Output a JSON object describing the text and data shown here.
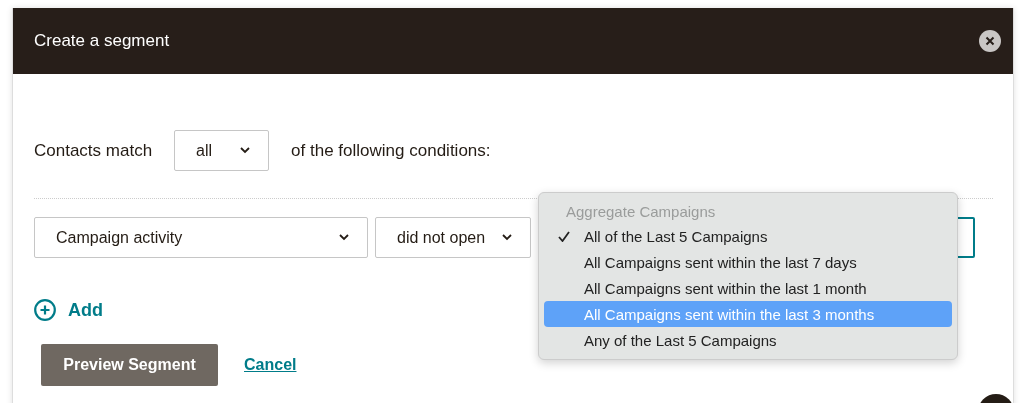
{
  "dialog": {
    "title": "Create a segment"
  },
  "match": {
    "prefix": "Contacts match",
    "value": "all",
    "suffix": "of the following conditions:"
  },
  "condition": {
    "field": "Campaign activity",
    "operator": "did not open",
    "focused": true
  },
  "add_label": "Add",
  "buttons": {
    "primary": "Preview Segment",
    "cancel": "Cancel"
  },
  "menu": {
    "group": "Aggregate Campaigns",
    "items": [
      {
        "label": "All of the Last 5 Campaigns",
        "checked": true,
        "selected": false
      },
      {
        "label": "All Campaigns sent within the last 7 days",
        "checked": false,
        "selected": false
      },
      {
        "label": "All Campaigns sent within the last 1 month",
        "checked": false,
        "selected": false
      },
      {
        "label": "All Campaigns sent within the last 3 months",
        "checked": false,
        "selected": true
      },
      {
        "label": "Any of the Last 5 Campaigns",
        "checked": false,
        "selected": false
      }
    ]
  }
}
